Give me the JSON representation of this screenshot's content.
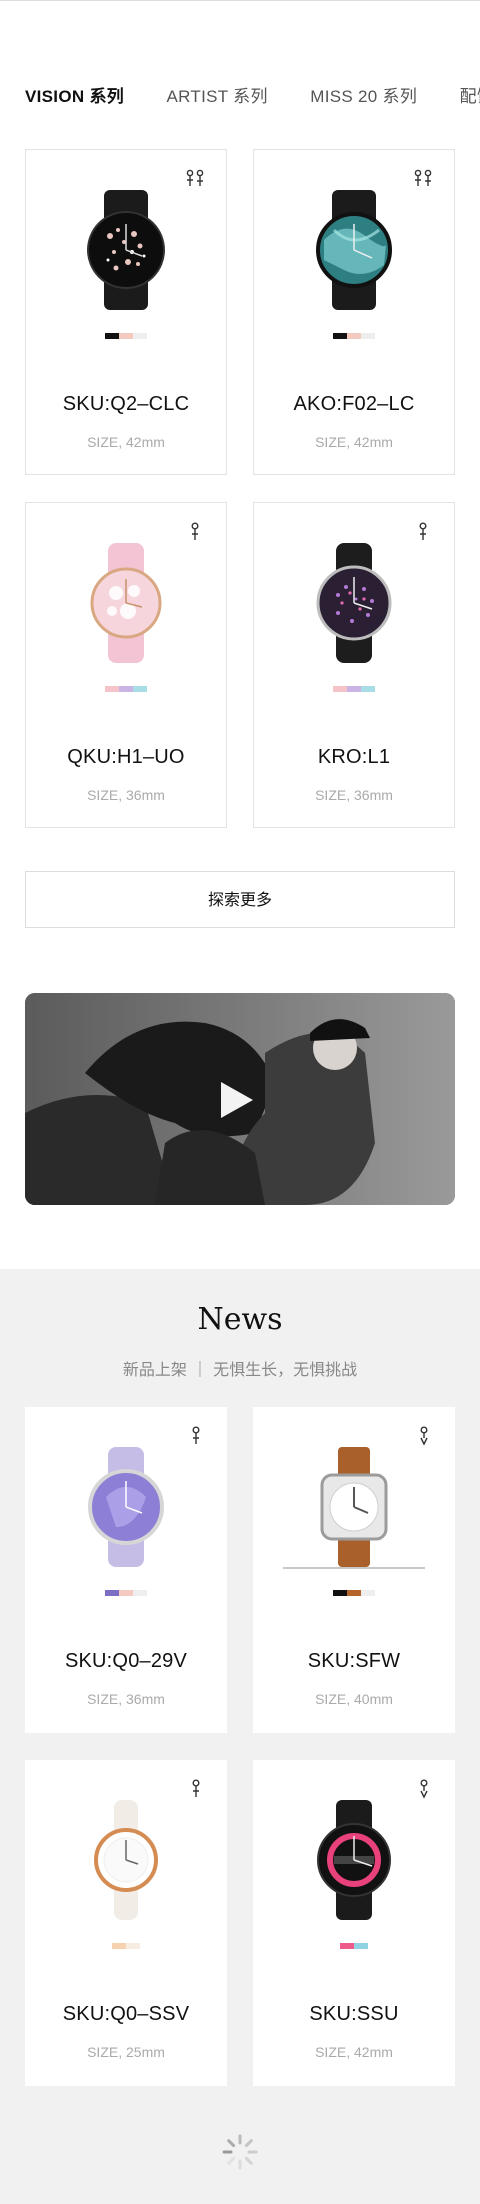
{
  "tabs": [
    {
      "label": "VISION 系列",
      "active": true
    },
    {
      "label": "ARTIST 系列",
      "active": false
    },
    {
      "label": "MISS 20 系列",
      "active": false
    },
    {
      "label": "配饰",
      "active": false
    }
  ],
  "products": [
    {
      "sku": "SKU:Q2–CLC",
      "size": "SIZE, 42mm",
      "gender": "couple",
      "colors": [
        "#111111",
        "#f3c9c0",
        "#eeeeee"
      ]
    },
    {
      "sku": "AKO:F02–LC",
      "size": "SIZE, 42mm",
      "gender": "couple",
      "colors": [
        "#111111",
        "#f3c9c0",
        "#eeeeee"
      ]
    },
    {
      "sku": "QKU:H1–UO",
      "size": "SIZE, 36mm",
      "gender": "female",
      "colors": [
        "#f6c4c8",
        "#c9b4e3",
        "#a9dde6"
      ]
    },
    {
      "sku": "KRO:L1",
      "size": "SIZE, 36mm",
      "gender": "female",
      "colors": [
        "#f6c4c8",
        "#c9b4e3",
        "#a9dde6"
      ]
    }
  ],
  "explore_button": "探索更多",
  "news": {
    "title": "News",
    "subtitle": "新品上架  ｜  无惧生长，无惧挑战",
    "products": [
      {
        "sku": "SKU:Q0–29V",
        "size": "SIZE, 36mm",
        "gender": "female",
        "colors": [
          "#7a6fc4",
          "#f3c9c0",
          "#eeeeee"
        ]
      },
      {
        "sku": "SKU:SFW",
        "size": "SIZE, 40mm",
        "gender": "male",
        "colors": [
          "#111111",
          "#b5652b",
          "#eeeeee"
        ]
      },
      {
        "sku": "SKU:Q0–SSV",
        "size": "SIZE, 25mm",
        "gender": "female",
        "colors": [
          "#f7d2b0",
          "#f7ece0"
        ]
      },
      {
        "sku": "SKU:SSU",
        "size": "SIZE, 42mm",
        "gender": "male",
        "colors": [
          "#f05a8a",
          "#8fd3e3"
        ]
      }
    ]
  }
}
